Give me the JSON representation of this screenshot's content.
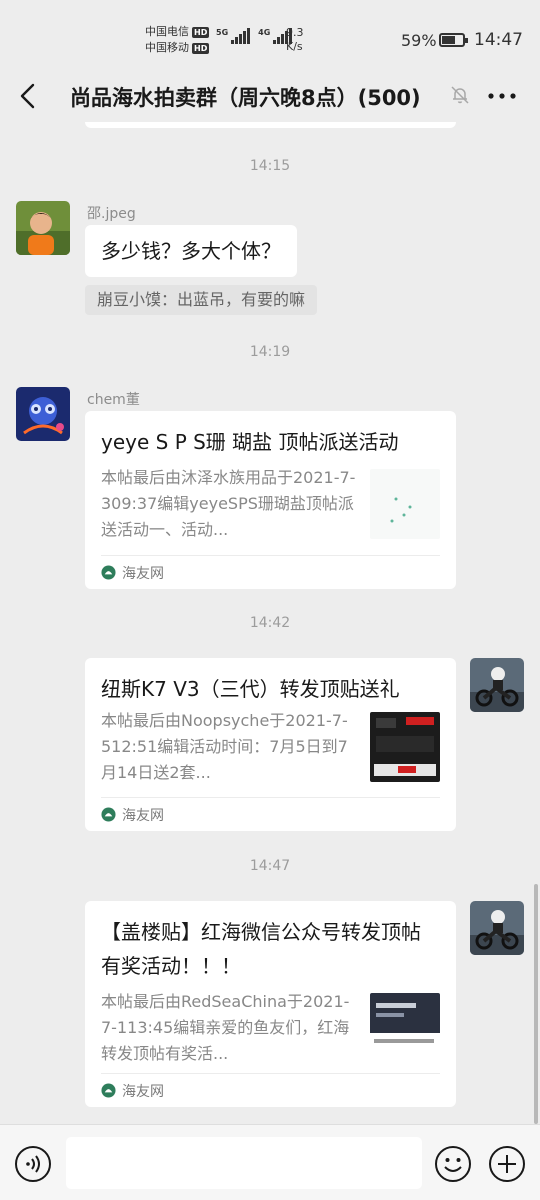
{
  "status": {
    "carrier1": "中国电信",
    "carrier2": "中国移动",
    "hd": "HD",
    "net1": "5G",
    "net2": "4G",
    "speed_value": "9.3",
    "speed_unit": "K/s",
    "battery": "59%",
    "battery_level": 0.59,
    "time": "14:47"
  },
  "header": {
    "title": "尚品海水拍卖群（周六晚8点）(500)",
    "back_icon": "chevron-left-icon",
    "mute_icon": "bell-off-icon",
    "more_icon": "more-dots-icon"
  },
  "messages": {
    "t1": "14:15",
    "m1": {
      "sender": "邵.jpeg",
      "text": "多少钱？多大个体？",
      "quote": "崩豆小馍：出蓝吊，有要的嘛"
    },
    "t2": "14:19",
    "m2": {
      "sender": "chem董",
      "title": "yeye S P S珊 瑚盐 顶帖派送活动",
      "desc": "本帖最后由沐泽水族用品于2021-7-309:37编辑yeyeSPS珊瑚盐顶帖派送活动一、活动...",
      "source": "海友网"
    },
    "t3": "14:42",
    "m3": {
      "title": "纽斯K7 V3（三代）转发顶贴送礼",
      "desc": "本帖最后由Noopsyche于2021-7-512:51编辑活动时间：7月5日到7月14日送2套...",
      "source": "海友网"
    },
    "t4": "14:47",
    "m4": {
      "title": "【盖楼贴】红海微信公众号转发顶帖有奖活动！！！",
      "desc": "本帖最后由RedSeaChina于2021-7-113:45编辑亲爱的鱼友们，红海转发顶帖有奖活...",
      "source": "海友网"
    }
  },
  "inputbar": {
    "voice_icon": "voice-icon",
    "emoji_icon": "emoji-icon",
    "plus_icon": "plus-icon"
  },
  "colors": {
    "background": "#ededed",
    "bubble": "#ffffff",
    "source_green": "#2e7d5b"
  }
}
